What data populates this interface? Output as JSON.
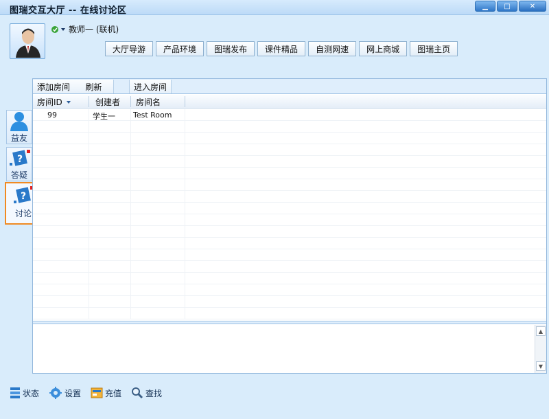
{
  "window": {
    "title": "图瑞交互大厅  --  在线讨论区",
    "min_label": "▁",
    "max_label": "□",
    "close_label": "✕"
  },
  "user": {
    "name": "教师一 (联机)",
    "status_icon": "check-circle-icon"
  },
  "nav": [
    {
      "label": "大厅导游"
    },
    {
      "label": "产品环境"
    },
    {
      "label": "图瑞发布"
    },
    {
      "label": "课件精品"
    },
    {
      "label": "自测网速"
    },
    {
      "label": "网上商城"
    },
    {
      "label": "图瑞主页"
    }
  ],
  "side_tabs": [
    {
      "label": "益友",
      "icon": "user-icon"
    },
    {
      "label": "答疑",
      "icon": "question-book-icon"
    },
    {
      "label": "讨论",
      "icon": "question-book-icon"
    }
  ],
  "toolbar": {
    "add_room": "添加房间",
    "refresh": "刷新",
    "enter_room": "进入房间"
  },
  "table": {
    "columns": [
      "房间ID",
      "创建者",
      "房间名"
    ],
    "rows": [
      {
        "id": "99",
        "creator": "学生一",
        "name": "Test Room"
      }
    ]
  },
  "footer": [
    {
      "label": "状态",
      "icon": "status-icon"
    },
    {
      "label": "设置",
      "icon": "settings-icon"
    },
    {
      "label": "充值",
      "icon": "recharge-icon"
    },
    {
      "label": "查找",
      "icon": "search-icon"
    }
  ],
  "colors": {
    "accent": "#f08a22",
    "title_blue": "#2f77c8",
    "panel_border": "#92b7dc"
  }
}
